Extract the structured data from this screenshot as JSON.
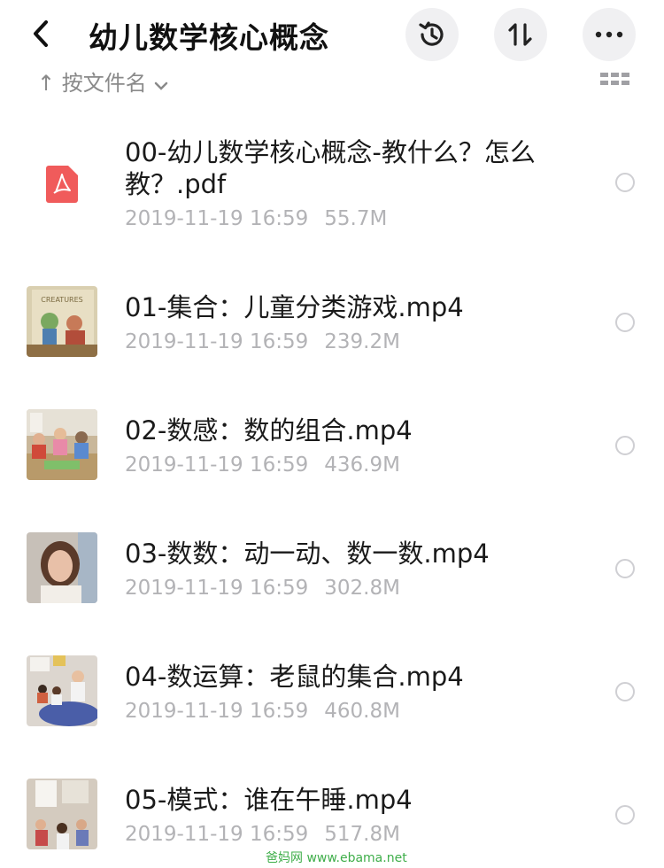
{
  "header": {
    "title": "幼儿数学核心概念",
    "back_icon": "chevron-left-icon",
    "actions": [
      "history-icon",
      "sort-icon",
      "more-icon"
    ]
  },
  "sortbar": {
    "label": "按文件名",
    "view_icon": "grid-view-icon"
  },
  "files": [
    {
      "name": "00-幼儿数学核心概念-教什么？怎么教？.pdf",
      "date": "2019-11-19 16:59",
      "size": "55.7M",
      "type": "pdf"
    },
    {
      "name": "01-集合：儿童分类游戏.mp4",
      "date": "2019-11-19 16:59",
      "size": "239.2M",
      "type": "video"
    },
    {
      "name": "02-数感：数的组合.mp4",
      "date": "2019-11-19 16:59",
      "size": "436.9M",
      "type": "video"
    },
    {
      "name": "03-数数：动一动、数一数.mp4",
      "date": "2019-11-19 16:59",
      "size": "302.8M",
      "type": "video"
    },
    {
      "name": "04-数运算：老鼠的集合.mp4",
      "date": "2019-11-19 16:59",
      "size": "460.8M",
      "type": "video"
    },
    {
      "name": "05-模式：谁在午睡.mp4",
      "date": "2019-11-19 16:59",
      "size": "517.8M",
      "type": "video"
    }
  ],
  "watermark": "爸妈网 www.ebama.net",
  "colors": {
    "pdf_red": "#f05b5b",
    "meta_gray": "#b3b3b6",
    "button_bg": "#f0f0f2"
  }
}
